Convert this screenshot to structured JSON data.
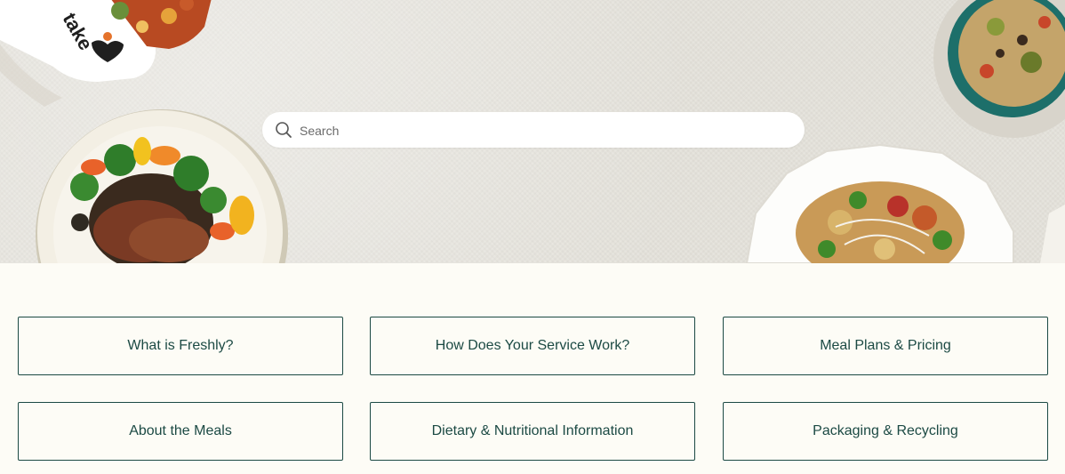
{
  "search": {
    "placeholder": "Search",
    "icon": "search-icon"
  },
  "hero": {
    "brand_text": "takeout by freshly"
  },
  "topics": [
    {
      "label": "What is Freshly?"
    },
    {
      "label": "How Does Your Service Work?"
    },
    {
      "label": "Meal Plans & Pricing"
    },
    {
      "label": "About the Meals"
    },
    {
      "label": "Dietary & Nutritional Information"
    },
    {
      "label": "Packaging & Recycling"
    }
  ],
  "colors": {
    "card_border": "#1c4a44",
    "card_text": "#1c4a44",
    "page_bg": "#fdfcf6",
    "hero_bg": "#e6e3dc"
  }
}
